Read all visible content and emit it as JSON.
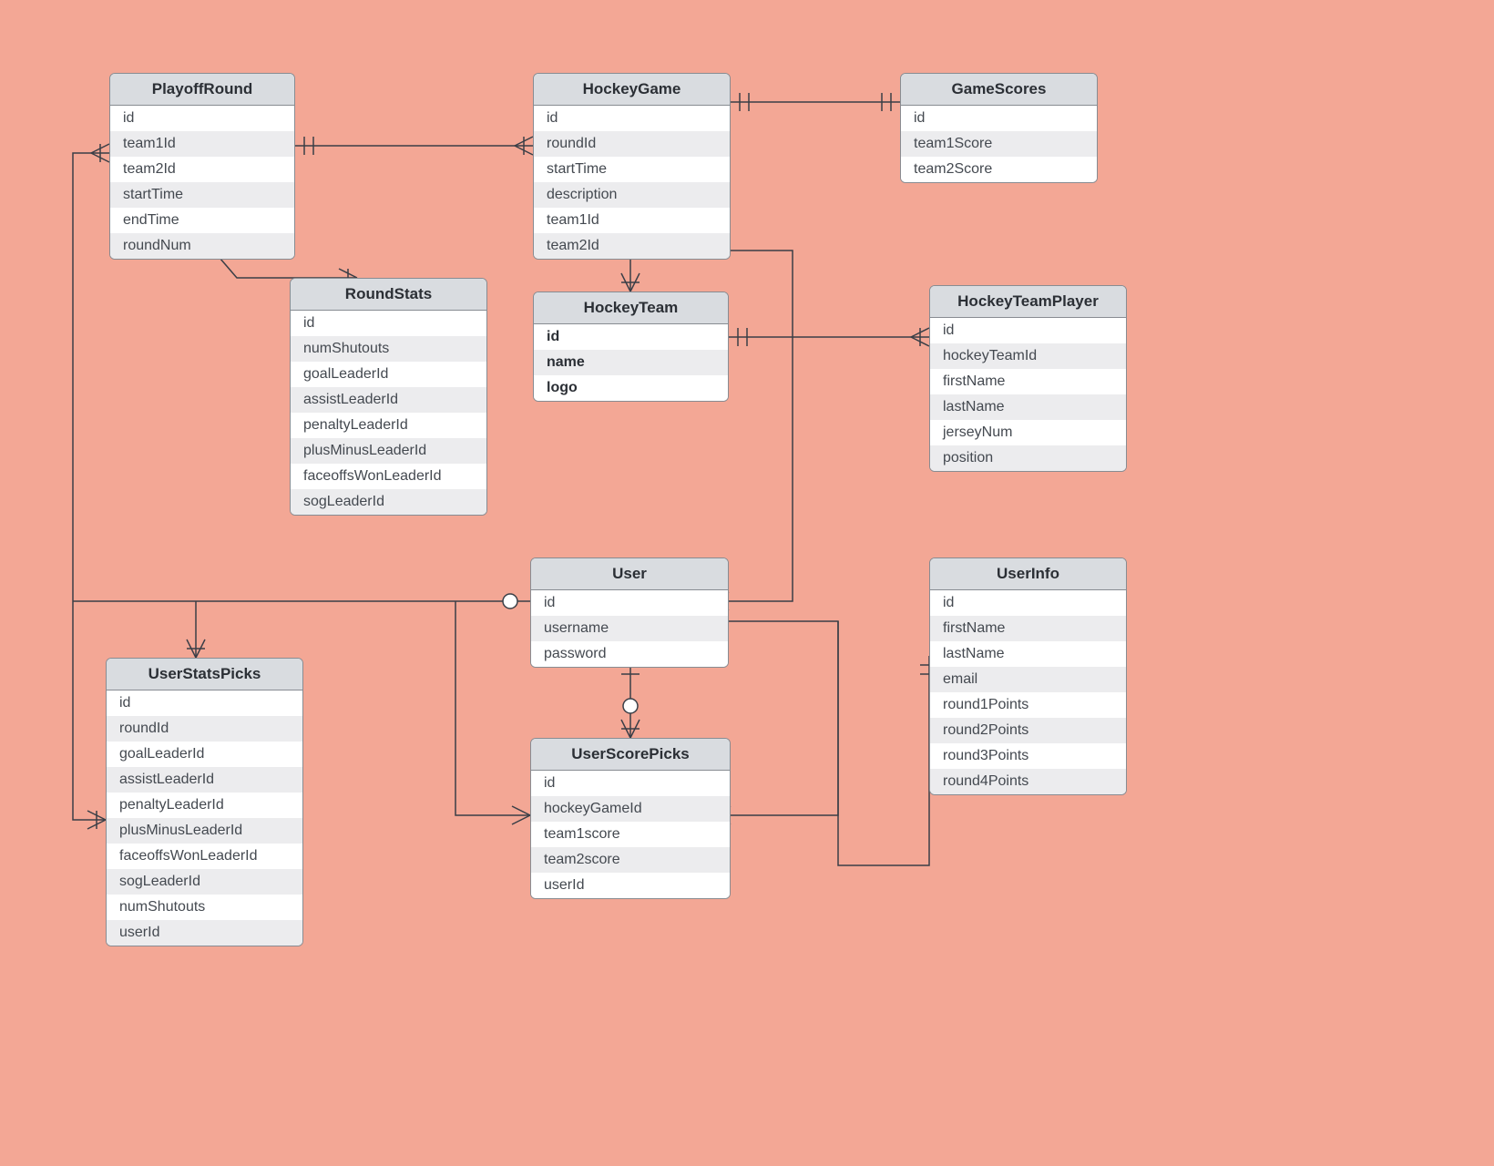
{
  "entities": {
    "playoffRound": {
      "title": "PlayoffRound",
      "fields": [
        "id",
        "team1Id",
        "team2Id",
        "startTime",
        "endTime",
        "roundNum"
      ]
    },
    "hockeyGame": {
      "title": "HockeyGame",
      "fields": [
        "id",
        "roundId",
        "startTime",
        "description",
        "team1Id",
        "team2Id"
      ]
    },
    "gameScores": {
      "title": "GameScores",
      "fields": [
        "id",
        "team1Score",
        "team2Score"
      ]
    },
    "roundStats": {
      "title": "RoundStats",
      "fields": [
        "id",
        "numShutouts",
        "goalLeaderId",
        "assistLeaderId",
        "penaltyLeaderId",
        "plusMinusLeaderId",
        "faceoffsWonLeaderId",
        "sogLeaderId"
      ]
    },
    "hockeyTeam": {
      "title": "HockeyTeam",
      "fields": [
        "id",
        "name",
        "logo"
      ],
      "bold": true
    },
    "hockeyTeamPlayer": {
      "title": "HockeyTeamPlayer",
      "fields": [
        "id",
        "hockeyTeamId",
        "firstName",
        "lastName",
        "jerseyNum",
        "position"
      ]
    },
    "user": {
      "title": "User",
      "fields": [
        "id",
        "username",
        "password"
      ]
    },
    "userInfo": {
      "title": "UserInfo",
      "fields": [
        "id",
        "firstName",
        "lastName",
        "email",
        "round1Points",
        "round2Points",
        "round3Points",
        "round4Points"
      ]
    },
    "userStatsPicks": {
      "title": "UserStatsPicks",
      "fields": [
        "id",
        "roundId",
        "goalLeaderId",
        "assistLeaderId",
        "penaltyLeaderId",
        "plusMinusLeaderId",
        "faceoffsWonLeaderId",
        "sogLeaderId",
        "numShutouts",
        "userId"
      ]
    },
    "userScorePicks": {
      "title": "UserScorePicks",
      "fields": [
        "id",
        "hockeyGameId",
        "team1score",
        "team2score",
        "userId"
      ]
    }
  },
  "styles": {
    "headerBg": "#d9dce0",
    "border": "#888c92",
    "stripeA": "#ffffff",
    "stripeB": "#ececee",
    "bg": "#f3a795"
  }
}
